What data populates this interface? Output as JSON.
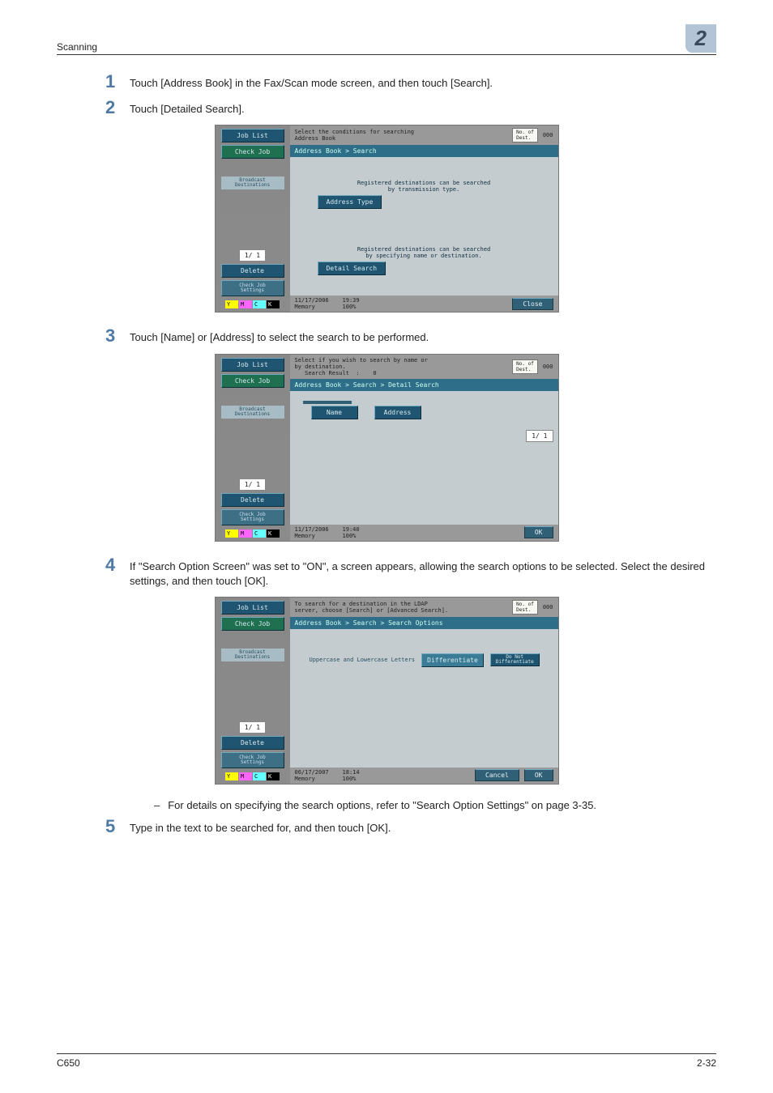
{
  "header": {
    "section": "Scanning",
    "chapter": "2"
  },
  "steps": {
    "s1": {
      "num": "1",
      "text": "Touch [Address Book] in the Fax/Scan mode screen, and then touch [Search]."
    },
    "s2": {
      "num": "2",
      "text": "Touch [Detailed Search]."
    },
    "s3": {
      "num": "3",
      "text": "Touch [Name] or [Address] to select the search to be performed."
    },
    "s4": {
      "num": "4",
      "text": "If \"Search Option Screen\" was set to \"ON\", a screen appears, allowing the search options to be selected. Select the desired settings, and then touch [OK]."
    },
    "s5": {
      "num": "5",
      "text": "Type in the text to be searched for, and then touch [OK]."
    }
  },
  "sub_bullet_4": "For details on specifying the search options, refer to \"Search Option Settings\" on page 3-35.",
  "ui_common": {
    "job_list": "Job List",
    "check_job": "Check Job",
    "broadcast": "Broadcast\nDestinations",
    "delete": "Delete",
    "check_job_settings": "Check Job\nSettings",
    "no_of_dest": "No. of\nDest.",
    "dest_count": "000",
    "memory": "Memory",
    "mem_pct": "100%",
    "pager": "1/  1",
    "ymck": [
      "Y",
      "M",
      "C",
      "K"
    ]
  },
  "ss1": {
    "msg": "Select the conditions for searching\nAddress Book",
    "crumb": "Address Book > Search",
    "hint1": "Registered destinations can be searched\nby transmission type.",
    "btn_addr_type": "Address Type",
    "hint2": "Registered destinations can be searched\nby specifying name or destination.",
    "btn_detail": "Detail Search",
    "date": "11/17/2006",
    "time": "19:39",
    "close": "Close"
  },
  "ss2": {
    "msg": "Select if you wish to search by name or\nby destination.\n   Search Result  :    0",
    "crumb": "Address Book > Search > Detail Search",
    "btn_name": "Name",
    "btn_address": "Address",
    "pager_right": "1/  1",
    "date": "11/17/2006",
    "time": "19:40",
    "ok": "OK"
  },
  "ss3": {
    "msg": "To search for a destination in the LDAP\nserver, choose [Search] or [Advanced Search].",
    "crumb": "Address Book > Search > Search Options",
    "opt_label": "Uppercase and Lowercase Letters",
    "btn_diff": "Differentiate",
    "btn_nodiff": "Do Not\nDifferentiate",
    "date": "06/17/2007",
    "time": "18:14",
    "cancel": "Cancel",
    "ok": "OK"
  },
  "footer": {
    "model": "C650",
    "page": "2-32"
  }
}
